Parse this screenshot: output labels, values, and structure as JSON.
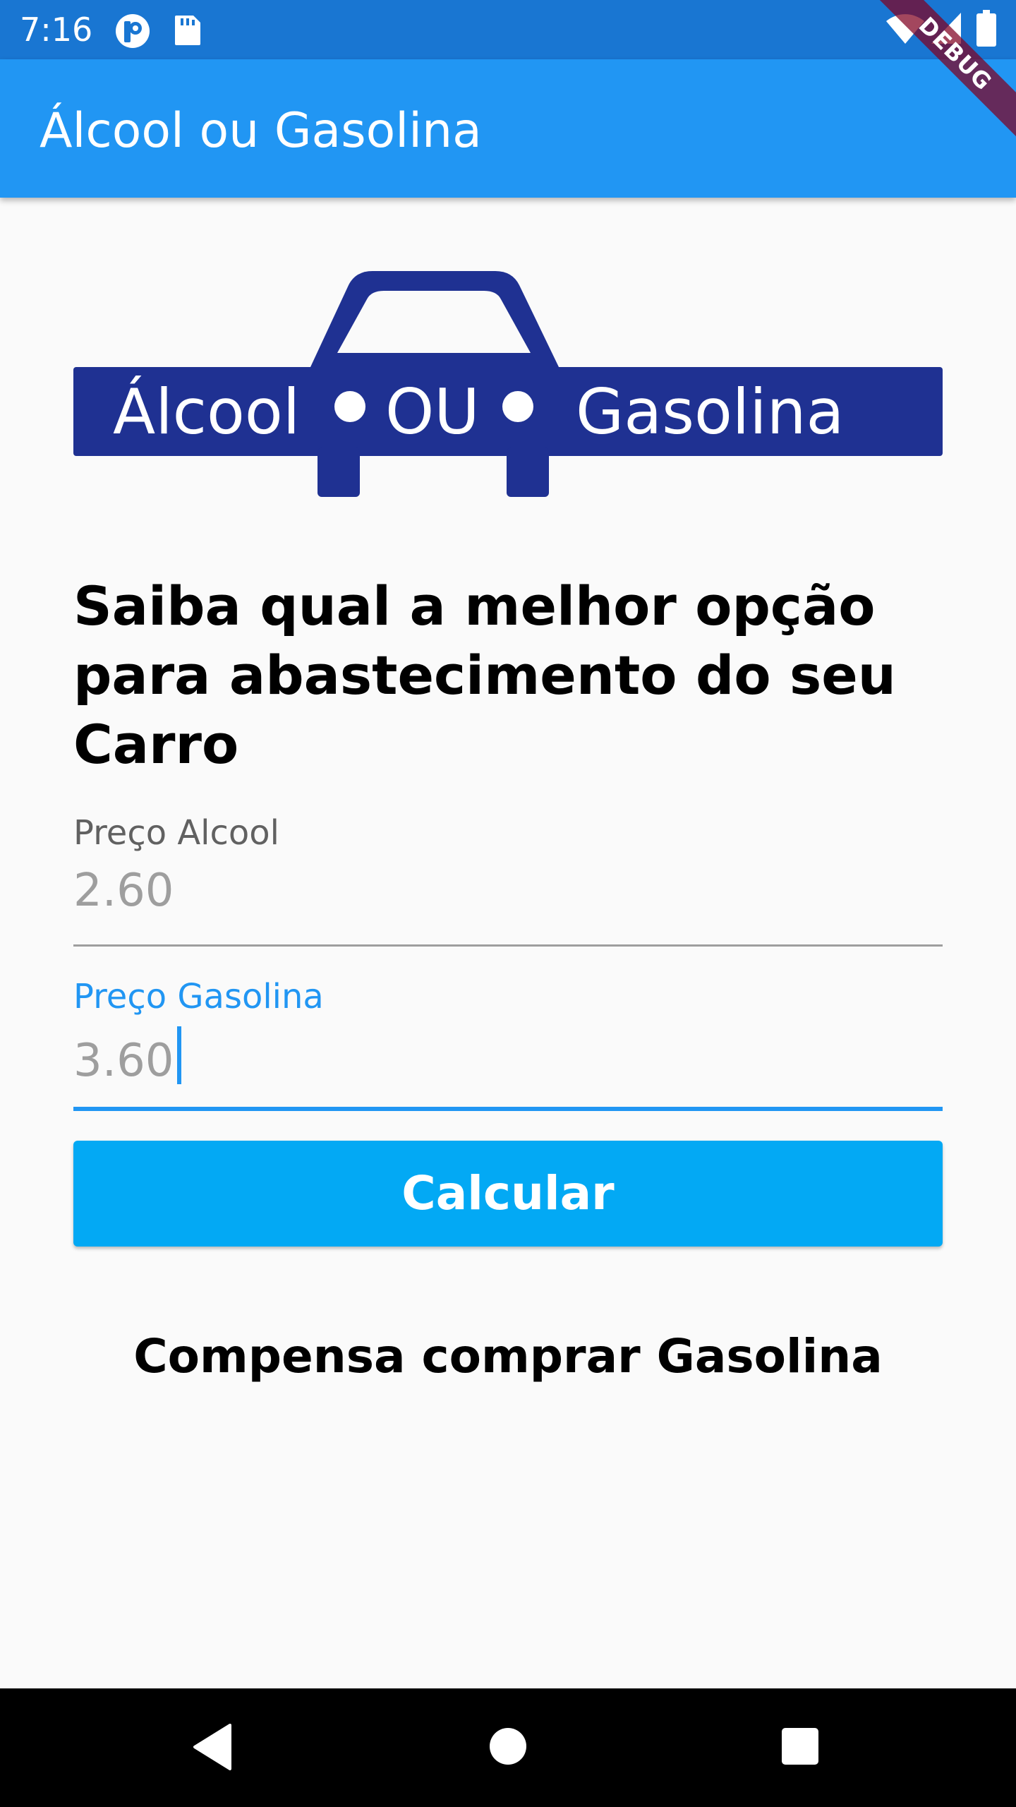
{
  "status_bar": {
    "time": "7:16",
    "left_icons": [
      "app-notification-icon",
      "sd-card-icon"
    ],
    "right_icons": [
      "wifi-icon",
      "cell-signal-icon",
      "battery-icon"
    ]
  },
  "debug_banner": {
    "label": "DEBUG"
  },
  "app_bar": {
    "title": "Álcool ou Gasolina"
  },
  "logo": {
    "word_left": "Álcool",
    "word_middle": "OU",
    "word_right": "Gasolina",
    "color": "#1f3192"
  },
  "headline": "Saiba qual a melhor opção para abastecimento do seu Carro",
  "fields": {
    "alcool": {
      "label": "Preço Alcool",
      "value": "2.60"
    },
    "gasolina": {
      "label": "Preço Gasolina",
      "value": "3.60"
    }
  },
  "calc_button": {
    "label": "Calcular"
  },
  "result": "Compensa comprar Gasolina",
  "nav_bar": {
    "icons": [
      "back-icon",
      "home-icon",
      "recents-icon"
    ]
  },
  "colors": {
    "status_bar": "#1976d2",
    "app_bar": "#2196f3",
    "button": "#03a9f4",
    "focus": "#2196f3",
    "logo": "#1f3192"
  }
}
